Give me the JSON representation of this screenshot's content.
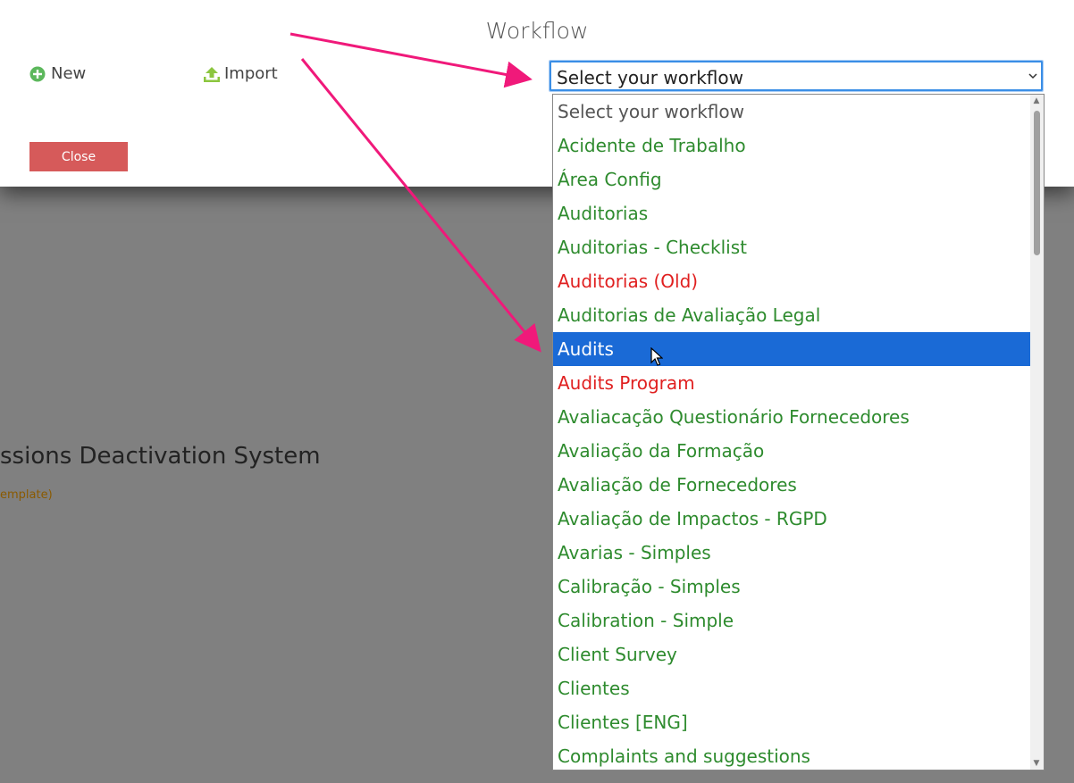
{
  "header": {
    "title": "Workflow",
    "new_label": "New",
    "import_label": "Import",
    "close_label": "Close"
  },
  "select": {
    "value": "Select your workflow"
  },
  "dropdown": {
    "options": [
      {
        "label": "Select your workflow",
        "color": "gray"
      },
      {
        "label": "Acidente de Trabalho",
        "color": "green"
      },
      {
        "label": "Área Config",
        "color": "green"
      },
      {
        "label": "Auditorias",
        "color": "green"
      },
      {
        "label": "Auditorias - Checklist",
        "color": "green"
      },
      {
        "label": "Auditorias (Old)",
        "color": "red"
      },
      {
        "label": "Auditorias de Avaliação Legal",
        "color": "green"
      },
      {
        "label": "Audits",
        "color": "green",
        "selected": true
      },
      {
        "label": "Audits Program",
        "color": "red"
      },
      {
        "label": "Avaliacação Questionário Fornecedores",
        "color": "green"
      },
      {
        "label": "Avaliação da Formação",
        "color": "green"
      },
      {
        "label": "Avaliação de Fornecedores",
        "color": "green"
      },
      {
        "label": "Avaliação de Impactos - RGPD",
        "color": "green"
      },
      {
        "label": "Avarias - Simples",
        "color": "green"
      },
      {
        "label": "Calibração - Simples",
        "color": "green"
      },
      {
        "label": "Calibration - Simple",
        "color": "green"
      },
      {
        "label": "Client Survey",
        "color": "green"
      },
      {
        "label": "Clientes",
        "color": "green"
      },
      {
        "label": "Clientes [ENG]",
        "color": "green"
      },
      {
        "label": "Complaints and suggestions",
        "color": "green"
      }
    ]
  },
  "background": {
    "title": "ssions Deactivation System",
    "subtitle": "emplate)"
  },
  "colors": {
    "accent": "#1a6ad6",
    "close_button": "#d65a5a",
    "green_item": "#2e8b2e",
    "red_item": "#e02020",
    "annotation_arrow": "#f0197a"
  },
  "icons": {
    "new": "plus-circle-icon",
    "import": "upload-icon",
    "cursor": "mouse-pointer-icon"
  }
}
